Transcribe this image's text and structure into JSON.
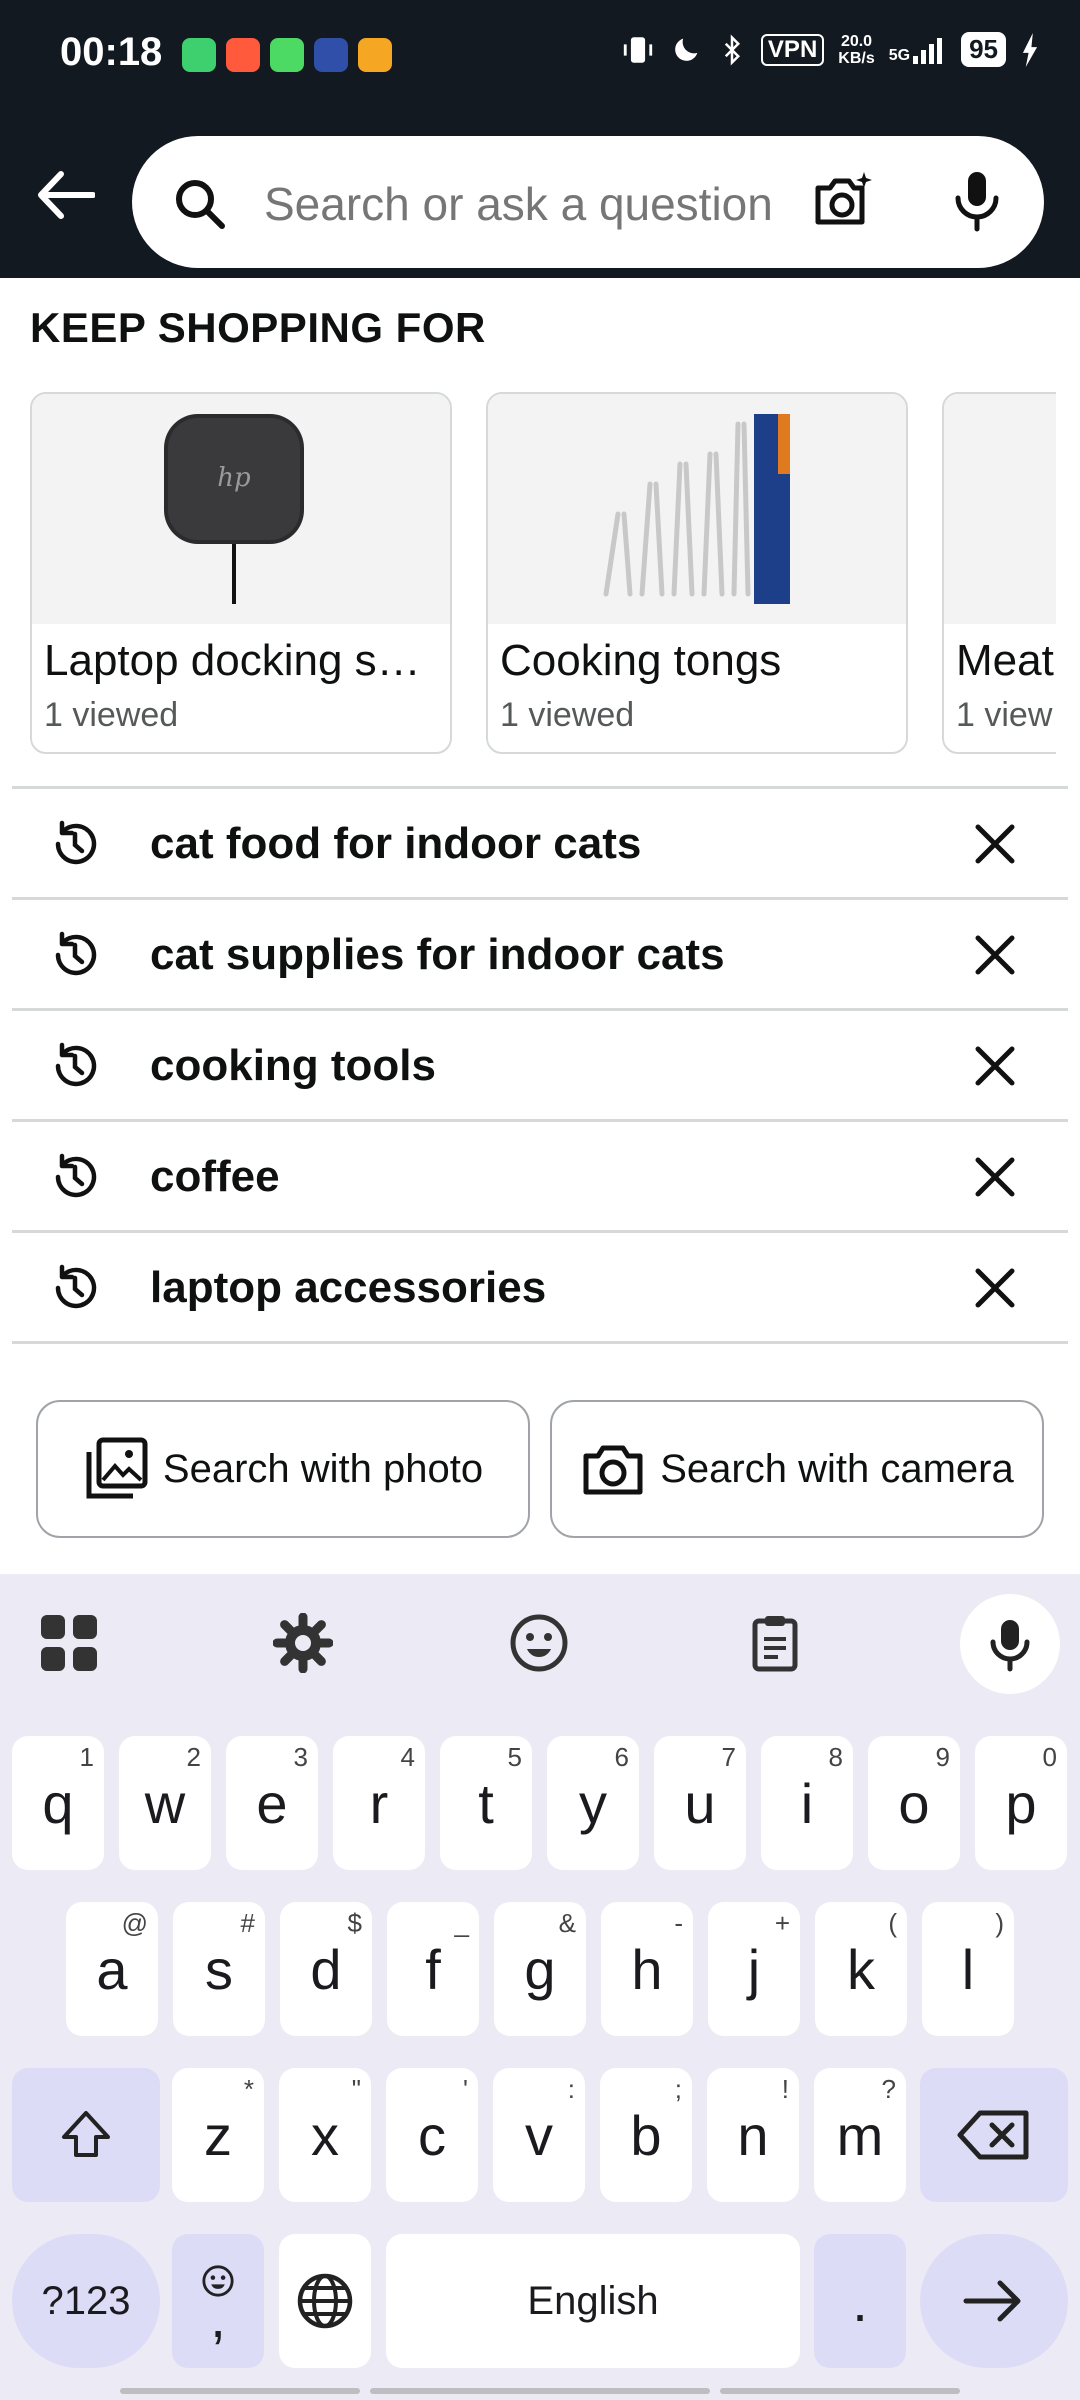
{
  "status_bar": {
    "time": "00:18",
    "vpn": "VPN",
    "speed_value": "20.0",
    "speed_unit": "KB/s",
    "network": "5G",
    "battery": "95",
    "icons": [
      "vibrate-icon",
      "moon-icon",
      "bluetooth-icon",
      "signal-icon",
      "charging-icon"
    ]
  },
  "search": {
    "placeholder": "Search or ask a question",
    "value": ""
  },
  "keep_shopping": {
    "title": "KEEP SHOPPING FOR",
    "items": [
      {
        "name": "Laptop docking s…",
        "sub": "1 viewed"
      },
      {
        "name": "Cooking tongs",
        "sub": "1 viewed"
      },
      {
        "name": "Meat",
        "sub": "1 view"
      }
    ]
  },
  "history": {
    "items": [
      {
        "text": "cat food for indoor cats"
      },
      {
        "text": "cat supplies for indoor cats"
      },
      {
        "text": "cooking tools"
      },
      {
        "text": "coffee"
      },
      {
        "text": "laptop accessories"
      }
    ]
  },
  "search_with": {
    "photo": "Search with photo",
    "camera": "Search with camera"
  },
  "keyboard": {
    "row1": [
      {
        "k": "q",
        "h": "1"
      },
      {
        "k": "w",
        "h": "2"
      },
      {
        "k": "e",
        "h": "3"
      },
      {
        "k": "r",
        "h": "4"
      },
      {
        "k": "t",
        "h": "5"
      },
      {
        "k": "y",
        "h": "6"
      },
      {
        "k": "u",
        "h": "7"
      },
      {
        "k": "i",
        "h": "8"
      },
      {
        "k": "o",
        "h": "9"
      },
      {
        "k": "p",
        "h": "0"
      }
    ],
    "row2": [
      {
        "k": "a",
        "h": "@"
      },
      {
        "k": "s",
        "h": "#"
      },
      {
        "k": "d",
        "h": "$"
      },
      {
        "k": "f",
        "h": "_"
      },
      {
        "k": "g",
        "h": "&"
      },
      {
        "k": "h",
        "h": "-"
      },
      {
        "k": "j",
        "h": "+"
      },
      {
        "k": "k",
        "h": "("
      },
      {
        "k": "l",
        "h": ")"
      }
    ],
    "row3": [
      {
        "k": "z",
        "h": "*"
      },
      {
        "k": "x",
        "h": "\""
      },
      {
        "k": "c",
        "h": "'"
      },
      {
        "k": "v",
        "h": ":"
      },
      {
        "k": "b",
        "h": ";"
      },
      {
        "k": "n",
        "h": "!"
      },
      {
        "k": "m",
        "h": "?"
      }
    ],
    "symbols_label": "?123",
    "comma_label": ",",
    "space_label": "English",
    "period_label": "."
  },
  "colors": {
    "header_bg": "#131921",
    "keyboard_bg": "#eceaf4",
    "modifier_key": "#dcdcf7"
  }
}
